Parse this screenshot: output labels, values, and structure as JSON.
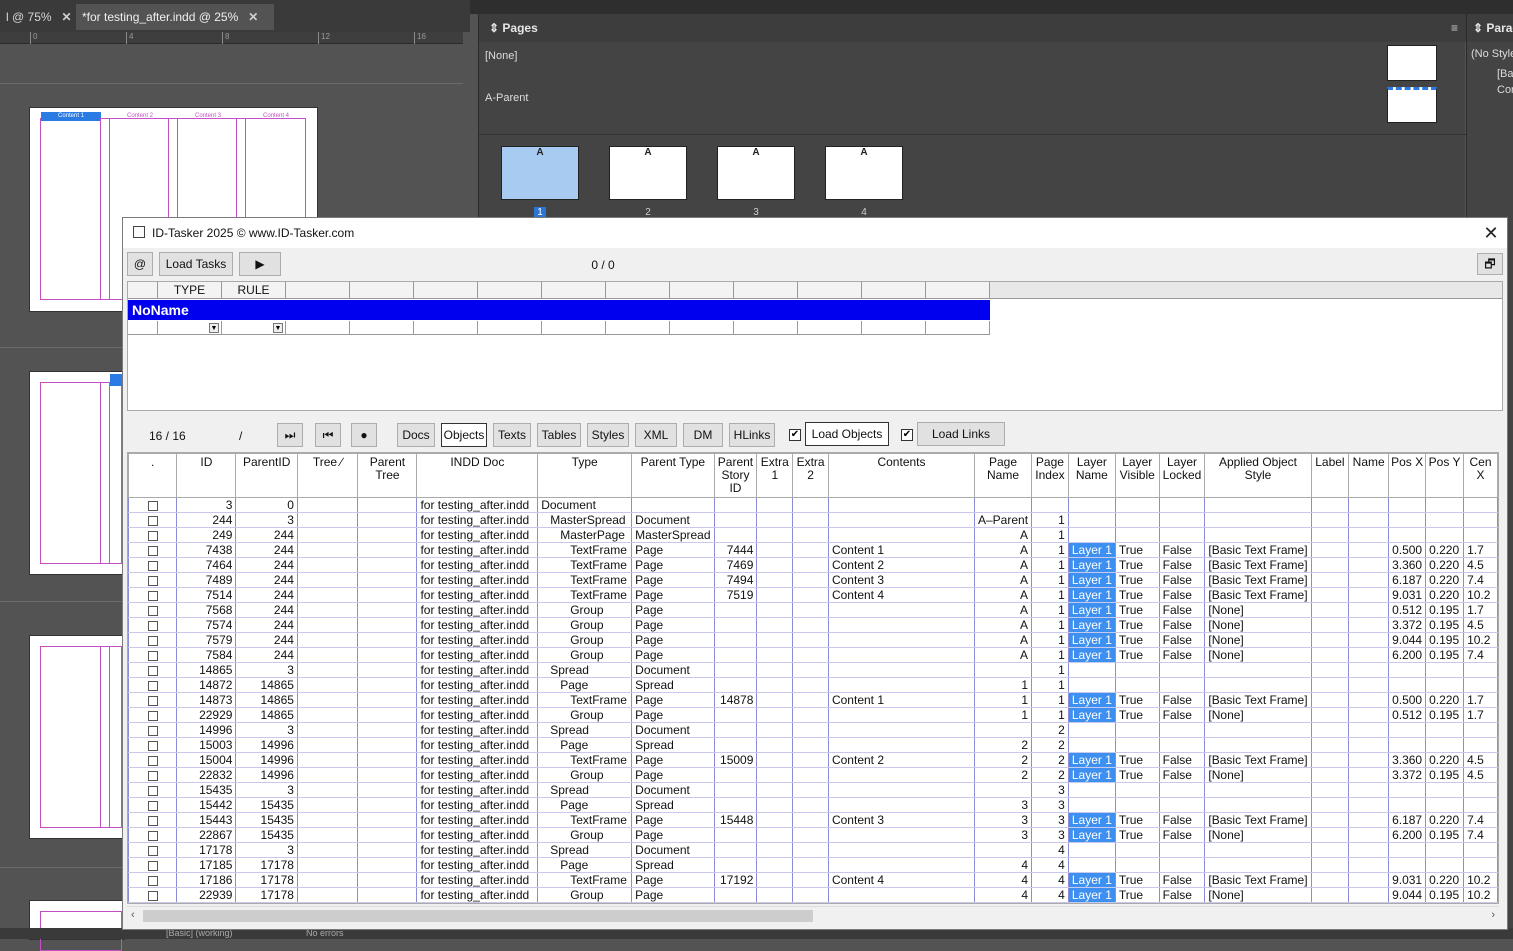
{
  "indesign": {
    "doc_tabs": [
      {
        "label": "l @ 75%"
      },
      {
        "label": "*for testing_after.indd @ 25%"
      }
    ],
    "ruler_ticks": [
      "0",
      "4",
      "8",
      "12",
      "16"
    ],
    "mini_page_labels": [
      "Content 1",
      "Content 2",
      "Content 3",
      "Content 4"
    ],
    "pages_panel": {
      "title": "Pages",
      "none_label": "[None]",
      "parent_label": "A-Parent",
      "page_numbers": [
        "1",
        "2",
        "3",
        "4"
      ],
      "page_prefix": "A"
    },
    "para_panel": {
      "title": "Parag",
      "item1": "(No Styles",
      "item2": "[Ba",
      "item3": "Cor"
    },
    "status": {
      "style": "[Basic] (working)",
      "errors": "No errors"
    }
  },
  "tasker": {
    "title": "ID-Tasker 2025  © www.ID-Tasker.com",
    "close": "✕",
    "at_button": "@",
    "load_tasks": "Load Tasks",
    "play": "▶",
    "counter": "0 / 0",
    "restore": "🗗",
    "rules": {
      "headers": [
        "",
        "TYPE",
        "RULE",
        "",
        "",
        "",
        "",
        "",
        "",
        "",
        "",
        "",
        ""
      ],
      "noname": "NoName"
    },
    "nav": {
      "counter": "16 / 16",
      "slash": "/",
      "last": "⏭",
      "first": "⏮",
      "record": "●"
    },
    "tabs": [
      "Docs",
      "Objects",
      "Texts",
      "Tables",
      "Styles",
      "XML",
      "DM",
      "HLinks"
    ],
    "load_objects": "Load Objects",
    "load_links": "Load Links",
    "load_objects_checked": "✔",
    "load_links_checked": "✔",
    "columns": [
      ".",
      "ID",
      "ParentID",
      "Tree ∕",
      "Parent Tree",
      "INDD Doc",
      "Type",
      "Parent Type",
      "Parent Story ID",
      "Extra 1",
      "Extra 2",
      "Contents",
      "Page Name",
      "Page Index",
      "Layer Name",
      "Layer Visible",
      "Layer Locked",
      "Applied Object Style",
      "Label",
      "Name",
      "Pos X",
      "Pos Y",
      "Cen X"
    ],
    "rows": [
      {
        "id": "3",
        "pid": "0",
        "doc": "for testing_after.indd",
        "type": "Document",
        "ind": 0,
        "ptype": "",
        "story": "",
        "contents": "",
        "pname": "",
        "pidx": "",
        "layer": "",
        "vis": "",
        "lock": "",
        "style": "",
        "px": "",
        "py": "",
        "cx": ""
      },
      {
        "id": "244",
        "pid": "3",
        "doc": "for testing_after.indd",
        "type": "MasterSpread",
        "ind": 1,
        "ptype": "Document",
        "story": "",
        "contents": "",
        "pname": "A–Parent",
        "pidx": "1",
        "layer": "",
        "vis": "",
        "lock": "",
        "style": "",
        "px": "",
        "py": "",
        "cx": ""
      },
      {
        "id": "249",
        "pid": "244",
        "doc": "for testing_after.indd",
        "type": "MasterPage",
        "ind": 2,
        "ptype": "MasterSpread",
        "story": "",
        "contents": "",
        "pname": "A",
        "pidx": "1",
        "layer": "",
        "vis": "",
        "lock": "",
        "style": "",
        "px": "",
        "py": "",
        "cx": ""
      },
      {
        "id": "7438",
        "pid": "244",
        "doc": "for testing_after.indd",
        "type": "TextFrame",
        "ind": 3,
        "ptype": "Page",
        "story": "7444",
        "contents": "Content 1",
        "pname": "A",
        "pidx": "1",
        "layer": "Layer 1",
        "vis": "True",
        "lock": "False",
        "style": "[Basic Text Frame]",
        "px": "0.500",
        "py": "0.220",
        "cx": "1.7"
      },
      {
        "id": "7464",
        "pid": "244",
        "doc": "for testing_after.indd",
        "type": "TextFrame",
        "ind": 3,
        "ptype": "Page",
        "story": "7469",
        "contents": "Content 2",
        "pname": "A",
        "pidx": "1",
        "layer": "Layer 1",
        "vis": "True",
        "lock": "False",
        "style": "[Basic Text Frame]",
        "px": "3.360",
        "py": "0.220",
        "cx": "4.5"
      },
      {
        "id": "7489",
        "pid": "244",
        "doc": "for testing_after.indd",
        "type": "TextFrame",
        "ind": 3,
        "ptype": "Page",
        "story": "7494",
        "contents": "Content 3",
        "pname": "A",
        "pidx": "1",
        "layer": "Layer 1",
        "vis": "True",
        "lock": "False",
        "style": "[Basic Text Frame]",
        "px": "6.187",
        "py": "0.220",
        "cx": "7.4"
      },
      {
        "id": "7514",
        "pid": "244",
        "doc": "for testing_after.indd",
        "type": "TextFrame",
        "ind": 3,
        "ptype": "Page",
        "story": "7519",
        "contents": "Content 4",
        "pname": "A",
        "pidx": "1",
        "layer": "Layer 1",
        "vis": "True",
        "lock": "False",
        "style": "[Basic Text Frame]",
        "px": "9.031",
        "py": "0.220",
        "cx": "10.2"
      },
      {
        "id": "7568",
        "pid": "244",
        "doc": "for testing_after.indd",
        "type": "Group",
        "ind": 3,
        "ptype": "Page",
        "story": "",
        "contents": "",
        "pname": "A",
        "pidx": "1",
        "layer": "Layer 1",
        "vis": "True",
        "lock": "False",
        "style": "[None]",
        "px": "0.512",
        "py": "0.195",
        "cx": "1.7"
      },
      {
        "id": "7574",
        "pid": "244",
        "doc": "for testing_after.indd",
        "type": "Group",
        "ind": 3,
        "ptype": "Page",
        "story": "",
        "contents": "",
        "pname": "A",
        "pidx": "1",
        "layer": "Layer 1",
        "vis": "True",
        "lock": "False",
        "style": "[None]",
        "px": "3.372",
        "py": "0.195",
        "cx": "4.5"
      },
      {
        "id": "7579",
        "pid": "244",
        "doc": "for testing_after.indd",
        "type": "Group",
        "ind": 3,
        "ptype": "Page",
        "story": "",
        "contents": "",
        "pname": "A",
        "pidx": "1",
        "layer": "Layer 1",
        "vis": "True",
        "lock": "False",
        "style": "[None]",
        "px": "9.044",
        "py": "0.195",
        "cx": "10.2"
      },
      {
        "id": "7584",
        "pid": "244",
        "doc": "for testing_after.indd",
        "type": "Group",
        "ind": 3,
        "ptype": "Page",
        "story": "",
        "contents": "",
        "pname": "A",
        "pidx": "1",
        "layer": "Layer 1",
        "vis": "True",
        "lock": "False",
        "style": "[None]",
        "px": "6.200",
        "py": "0.195",
        "cx": "7.4"
      },
      {
        "id": "14865",
        "pid": "3",
        "doc": "for testing_after.indd",
        "type": "Spread",
        "ind": 1,
        "ptype": "Document",
        "story": "",
        "contents": "",
        "pname": "",
        "pidx": "1",
        "layer": "",
        "vis": "",
        "lock": "",
        "style": "",
        "px": "",
        "py": "",
        "cx": ""
      },
      {
        "id": "14872",
        "pid": "14865",
        "doc": "for testing_after.indd",
        "type": "Page",
        "ind": 2,
        "ptype": "Spread",
        "story": "",
        "contents": "",
        "pname": "1",
        "pidx": "1",
        "layer": "",
        "vis": "",
        "lock": "",
        "style": "",
        "px": "",
        "py": "",
        "cx": ""
      },
      {
        "id": "14873",
        "pid": "14865",
        "doc": "for testing_after.indd",
        "type": "TextFrame",
        "ind": 3,
        "ptype": "Page",
        "story": "14878",
        "contents": "Content 1",
        "pname": "1",
        "pidx": "1",
        "layer": "Layer 1",
        "vis": "True",
        "lock": "False",
        "style": "[Basic Text Frame]",
        "px": "0.500",
        "py": "0.220",
        "cx": "1.7"
      },
      {
        "id": "22929",
        "pid": "14865",
        "doc": "for testing_after.indd",
        "type": "Group",
        "ind": 3,
        "ptype": "Page",
        "story": "",
        "contents": "",
        "pname": "1",
        "pidx": "1",
        "layer": "Layer 1",
        "vis": "True",
        "lock": "False",
        "style": "[None]",
        "px": "0.512",
        "py": "0.195",
        "cx": "1.7"
      },
      {
        "id": "14996",
        "pid": "3",
        "doc": "for testing_after.indd",
        "type": "Spread",
        "ind": 1,
        "ptype": "Document",
        "story": "",
        "contents": "",
        "pname": "",
        "pidx": "2",
        "layer": "",
        "vis": "",
        "lock": "",
        "style": "",
        "px": "",
        "py": "",
        "cx": ""
      },
      {
        "id": "15003",
        "pid": "14996",
        "doc": "for testing_after.indd",
        "type": "Page",
        "ind": 2,
        "ptype": "Spread",
        "story": "",
        "contents": "",
        "pname": "2",
        "pidx": "2",
        "layer": "",
        "vis": "",
        "lock": "",
        "style": "",
        "px": "",
        "py": "",
        "cx": ""
      },
      {
        "id": "15004",
        "pid": "14996",
        "doc": "for testing_after.indd",
        "type": "TextFrame",
        "ind": 3,
        "ptype": "Page",
        "story": "15009",
        "contents": "Content 2",
        "pname": "2",
        "pidx": "2",
        "layer": "Layer 1",
        "vis": "True",
        "lock": "False",
        "style": "[Basic Text Frame]",
        "px": "3.360",
        "py": "0.220",
        "cx": "4.5"
      },
      {
        "id": "22832",
        "pid": "14996",
        "doc": "for testing_after.indd",
        "type": "Group",
        "ind": 3,
        "ptype": "Page",
        "story": "",
        "contents": "",
        "pname": "2",
        "pidx": "2",
        "layer": "Layer 1",
        "vis": "True",
        "lock": "False",
        "style": "[None]",
        "px": "3.372",
        "py": "0.195",
        "cx": "4.5"
      },
      {
        "id": "15435",
        "pid": "3",
        "doc": "for testing_after.indd",
        "type": "Spread",
        "ind": 1,
        "ptype": "Document",
        "story": "",
        "contents": "",
        "pname": "",
        "pidx": "3",
        "layer": "",
        "vis": "",
        "lock": "",
        "style": "",
        "px": "",
        "py": "",
        "cx": ""
      },
      {
        "id": "15442",
        "pid": "15435",
        "doc": "for testing_after.indd",
        "type": "Page",
        "ind": 2,
        "ptype": "Spread",
        "story": "",
        "contents": "",
        "pname": "3",
        "pidx": "3",
        "layer": "",
        "vis": "",
        "lock": "",
        "style": "",
        "px": "",
        "py": "",
        "cx": ""
      },
      {
        "id": "15443",
        "pid": "15435",
        "doc": "for testing_after.indd",
        "type": "TextFrame",
        "ind": 3,
        "ptype": "Page",
        "story": "15448",
        "contents": "Content 3",
        "pname": "3",
        "pidx": "3",
        "layer": "Layer 1",
        "vis": "True",
        "lock": "False",
        "style": "[Basic Text Frame]",
        "px": "6.187",
        "py": "0.220",
        "cx": "7.4"
      },
      {
        "id": "22867",
        "pid": "15435",
        "doc": "for testing_after.indd",
        "type": "Group",
        "ind": 3,
        "ptype": "Page",
        "story": "",
        "contents": "",
        "pname": "3",
        "pidx": "3",
        "layer": "Layer 1",
        "vis": "True",
        "lock": "False",
        "style": "[None]",
        "px": "6.200",
        "py": "0.195",
        "cx": "7.4"
      },
      {
        "id": "17178",
        "pid": "3",
        "doc": "for testing_after.indd",
        "type": "Spread",
        "ind": 1,
        "ptype": "Document",
        "story": "",
        "contents": "",
        "pname": "",
        "pidx": "4",
        "layer": "",
        "vis": "",
        "lock": "",
        "style": "",
        "px": "",
        "py": "",
        "cx": ""
      },
      {
        "id": "17185",
        "pid": "17178",
        "doc": "for testing_after.indd",
        "type": "Page",
        "ind": 2,
        "ptype": "Spread",
        "story": "",
        "contents": "",
        "pname": "4",
        "pidx": "4",
        "layer": "",
        "vis": "",
        "lock": "",
        "style": "",
        "px": "",
        "py": "",
        "cx": ""
      },
      {
        "id": "17186",
        "pid": "17178",
        "doc": "for testing_after.indd",
        "type": "TextFrame",
        "ind": 3,
        "ptype": "Page",
        "story": "17192",
        "contents": "Content 4",
        "pname": "4",
        "pidx": "4",
        "layer": "Layer 1",
        "vis": "True",
        "lock": "False",
        "style": "[Basic Text Frame]",
        "px": "9.031",
        "py": "0.220",
        "cx": "10.2"
      },
      {
        "id": "22939",
        "pid": "17178",
        "doc": "for testing_after.indd",
        "type": "Group",
        "ind": 3,
        "ptype": "Page",
        "story": "",
        "contents": "",
        "pname": "4",
        "pidx": "4",
        "layer": "Layer 1",
        "vis": "True",
        "lock": "False",
        "style": "[None]",
        "px": "9.044",
        "py": "0.195",
        "cx": "10.2"
      }
    ]
  },
  "colors": {
    "layer_highlight": "#3d8ff0",
    "noname_bar": "#0000ee",
    "spread_selected": "#a7cbf1"
  }
}
